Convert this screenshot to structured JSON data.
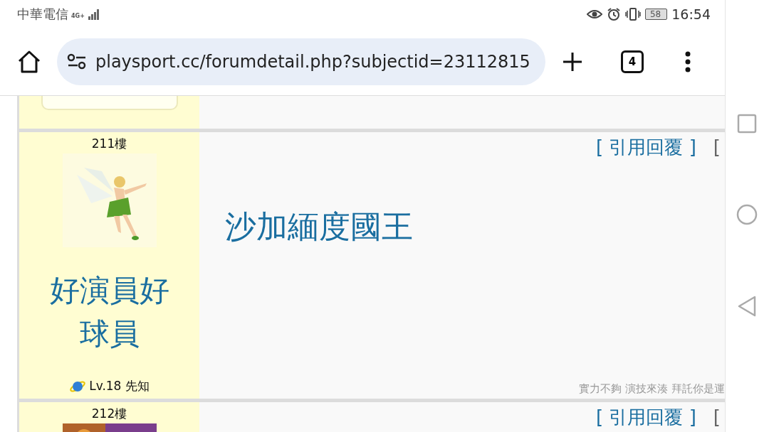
{
  "status_bar": {
    "carrier": "中華電信",
    "network": "4G+",
    "battery": "58",
    "time": "16:54"
  },
  "browser": {
    "url": "playsport.cc/forumdetail.php?subjectid=23112815",
    "tab_count": "4"
  },
  "posts": [
    {
      "floor": "211樓",
      "nickname": "好演員好球員",
      "level": "Lv.18 先知",
      "body": "沙加緬度國王",
      "actions": [
        {
          "label": "[ 引用回覆 ]",
          "color": "#1a6ea0"
        },
        {
          "label": "[",
          "color": "#666666"
        }
      ],
      "signature": "實力不夠 演技來湊 拜託你是運"
    },
    {
      "floor": "212樓",
      "actions": [
        {
          "label": "[ 引用回覆 ]",
          "color": "#1a6ea0"
        },
        {
          "label": "[",
          "color": "#666666"
        }
      ]
    }
  ]
}
